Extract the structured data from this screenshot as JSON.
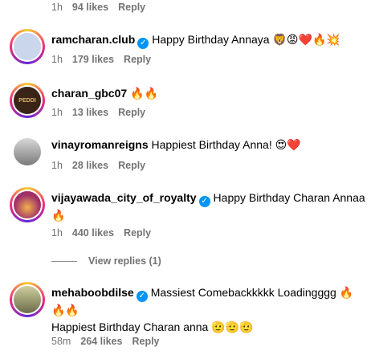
{
  "top_meta": {
    "time": "1h",
    "likes": "94 likes",
    "reply": "Reply"
  },
  "comments": [
    {
      "user": "ramcharan.club",
      "verified": true,
      "text": "Happy Birthday Annaya",
      "emojis": "🦁😡❤️🔥💥",
      "time": "1h",
      "likes": "179 likes",
      "reply": "Reply",
      "avatar_color": "#c9d6ec"
    },
    {
      "user": "charan_gbc07",
      "verified": false,
      "text": "",
      "emojis": "🔥🔥",
      "time": "1h",
      "likes": "13 likes",
      "reply": "Reply",
      "avatar_color": "#3a2418",
      "avatar_text": "PEDDI"
    },
    {
      "user": "vinayromanreigns",
      "verified": false,
      "text": "Happiest Birthday Anna!",
      "emojis": "😍❤️",
      "time": "1h",
      "likes": "28 likes",
      "reply": "Reply",
      "avatar_color": "#a9a9a9"
    },
    {
      "user": "vijayawada_city_of_royalty",
      "verified": true,
      "text": "Happy Birthday Charan Annaa",
      "emojis": "🔥",
      "time": "1h",
      "likes": "440 likes",
      "reply": "Reply",
      "avatar_color": "#a0306a"
    },
    {
      "user": "mehaboobdilse",
      "verified": true,
      "text": "Massiest Comebackkkkk Loadingggg",
      "emojis": "🔥🔥🔥",
      "line2": "Happiest Birthday Charan anna",
      "line2_emojis": "🫡🫡🫡",
      "time": "58m",
      "likes": "264 likes",
      "reply": "Reply",
      "avatar_color": "#6b6b48"
    }
  ],
  "view_replies": "View replies (1)",
  "colors": {
    "verified": "#0095f6",
    "meta": "#737373"
  }
}
